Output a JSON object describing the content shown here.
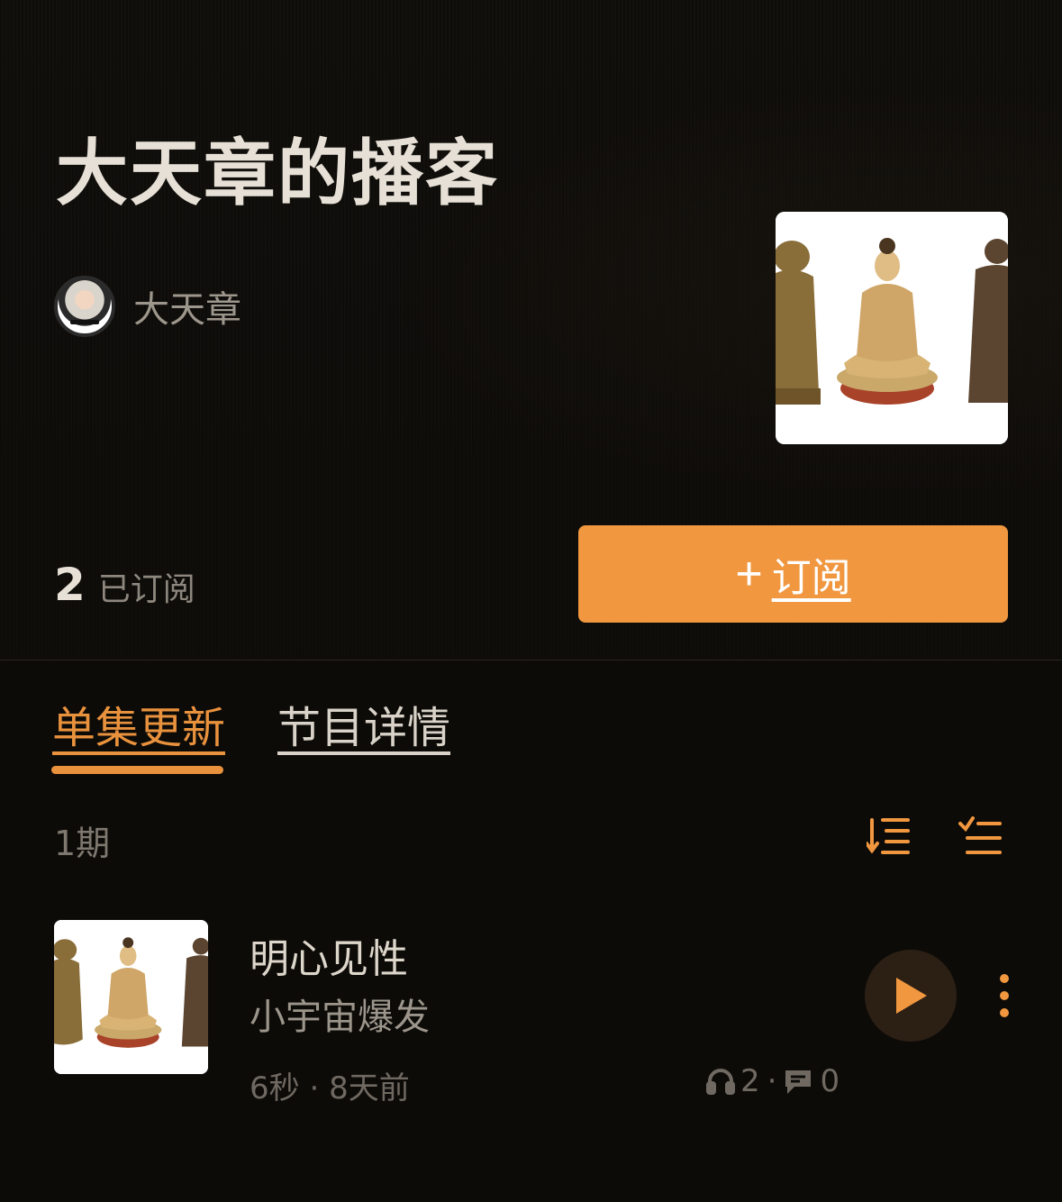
{
  "podcast": {
    "title": "大天章的播客",
    "author": "大天章",
    "subscriber_count": "2",
    "subscriber_label": "已订阅",
    "subscribe_button": "订阅"
  },
  "tabs": [
    {
      "label": "单集更新",
      "active": true
    },
    {
      "label": "节目详情",
      "active": false
    }
  ],
  "episode_list": {
    "count_label": "1期",
    "episodes": [
      {
        "title": "明心见性",
        "subtitle": "小宇宙爆发",
        "duration": "6秒",
        "published": "8天前",
        "plays": "2",
        "comments": "0"
      }
    ]
  },
  "colors": {
    "accent": "#f0973f",
    "background": "#0d0b08",
    "play_button_bg": "#2c2015"
  },
  "icons": {
    "sort": "sort-icon",
    "select": "checklist-icon",
    "play": "play-icon",
    "more": "more-vertical-icon",
    "headphones": "headphones-icon",
    "comment": "comment-icon"
  }
}
